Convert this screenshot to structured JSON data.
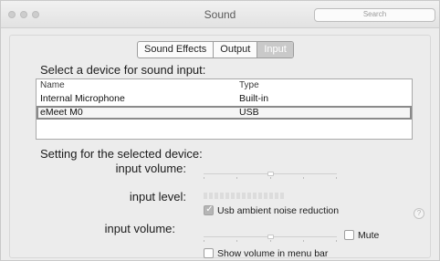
{
  "window": {
    "title": "Sound"
  },
  "search": {
    "placeholder": "Search"
  },
  "tabs": [
    {
      "label": "Sound Effects",
      "selected": false
    },
    {
      "label": "Output",
      "selected": false
    },
    {
      "label": "Input",
      "selected": true
    }
  ],
  "input_section": {
    "heading": "Select a device for sound input:",
    "columns": [
      "Name",
      "Type"
    ],
    "devices": [
      {
        "name": "Internal Microphone",
        "type": "Built-in",
        "selected": false
      },
      {
        "name": "eMeet M0",
        "type": "USB",
        "selected": true
      }
    ]
  },
  "settings": {
    "heading": "Setting for the selected device:",
    "input_volume_label": "input volume:",
    "input_volume_level": 0.5,
    "input_level_label": "input level:",
    "input_level_segments": 15,
    "input_level_active": 0,
    "noise_reduction_label": "Usb ambient noise reduction",
    "noise_reduction_checked": true
  },
  "output": {
    "volume_label": "input volume:",
    "volume_level": 0.5,
    "mute_label": "Mute",
    "mute_checked": false,
    "menu_bar_label": "Show volume in menu bar",
    "menu_bar_checked": false
  },
  "help": {
    "glyph": "?"
  },
  "colors": {
    "window_bg": "#ececec",
    "selected_tab": "#c9c9c9",
    "checkbox_checked": "#b5b5b5"
  }
}
